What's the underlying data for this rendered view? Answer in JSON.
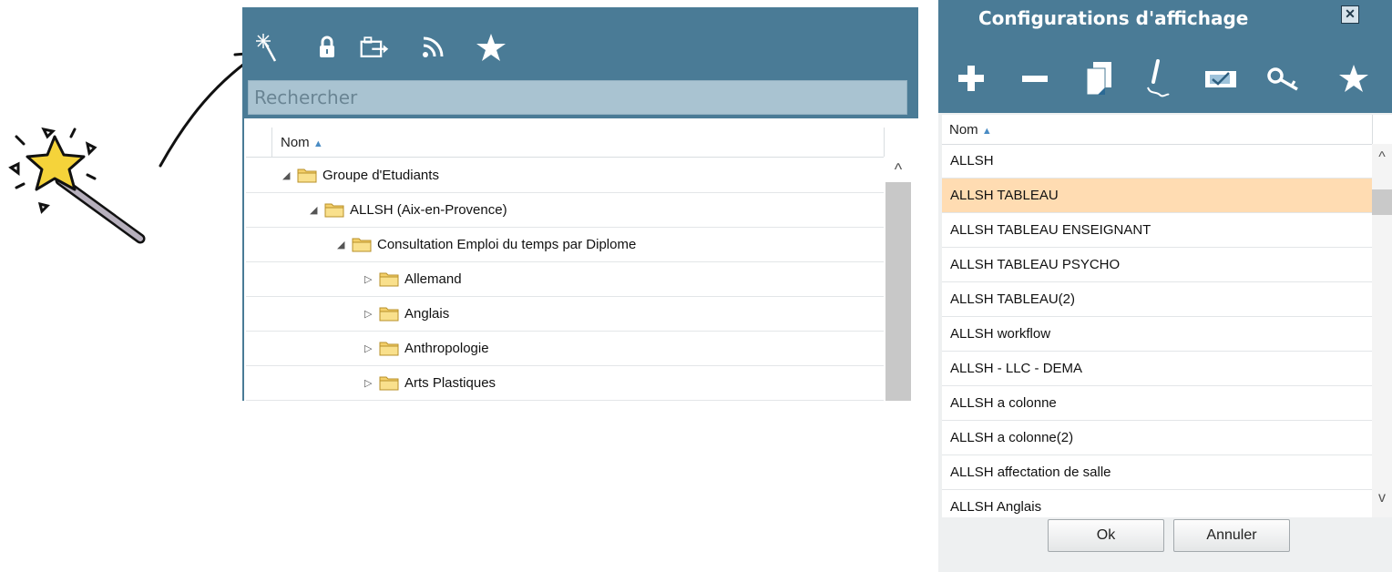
{
  "left_panel": {
    "toolbar_icons": [
      "magic-wand-icon",
      "lock-icon",
      "export-icon",
      "rss-icon",
      "star-icon"
    ],
    "search": {
      "placeholder": "Rechercher"
    },
    "column_header": "Nom",
    "sort_indicator": "▲",
    "tree": [
      {
        "label": "Groupe d'Etudiants",
        "level": 0,
        "expanded": true
      },
      {
        "label": "ALLSH (Aix-en-Provence)",
        "level": 1,
        "expanded": true
      },
      {
        "label": "Consultation Emploi du temps par Diplome",
        "level": 2,
        "expanded": true
      },
      {
        "label": "Allemand",
        "level": 3,
        "expanded": false
      },
      {
        "label": "Anglais",
        "level": 3,
        "expanded": false
      },
      {
        "label": "Anthropologie",
        "level": 3,
        "expanded": false
      },
      {
        "label": "Arts Plastiques",
        "level": 3,
        "expanded": false
      }
    ]
  },
  "dialog": {
    "title": "Configurations d'affichage",
    "close_label": "✕",
    "toolbar_icons": [
      "add-icon",
      "remove-icon",
      "copy-icon",
      "edit-icon",
      "apply-icon",
      "key-icon",
      "star-icon"
    ],
    "column_header": "Nom",
    "sort_indicator": "▲",
    "items": [
      "ALLSH",
      "ALLSH TABLEAU",
      "ALLSH TABLEAU ENSEIGNANT",
      "ALLSH TABLEAU PSYCHO",
      "ALLSH TABLEAU(2)",
      "ALLSH workflow",
      "ALLSH - LLC - DEMA",
      "ALLSH a colonne",
      "ALLSH a colonne(2)",
      "ALLSH affectation de salle",
      "ALLSH Anglais"
    ],
    "selected_index": 1,
    "ok_label": "Ok",
    "cancel_label": "Annuler"
  },
  "colors": {
    "toolbar_blue": "#4a7b96",
    "search_bg": "#a9c3d1",
    "selection": "#ffdcb2",
    "star": "#f5d33a"
  }
}
